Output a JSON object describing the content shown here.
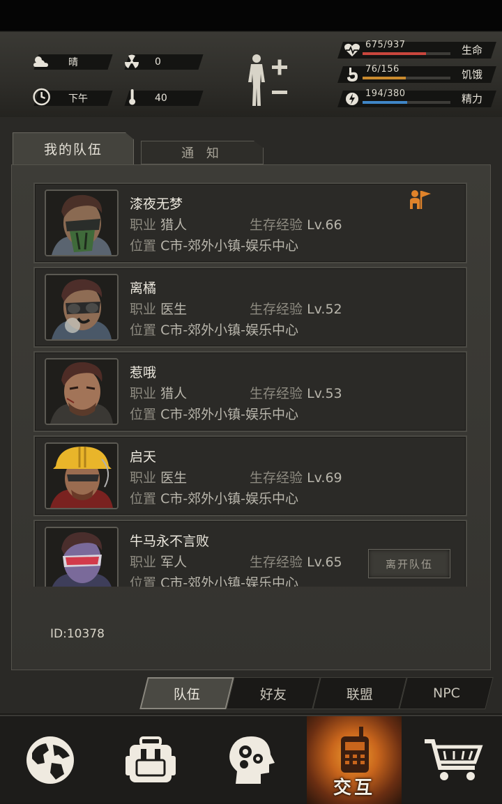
{
  "status": {
    "weather": {
      "icon": "cloud-sun-icon",
      "text": "晴"
    },
    "radiation": {
      "icon": "radiation-icon",
      "text": "0"
    },
    "time": {
      "icon": "clock-icon",
      "text": "下午"
    },
    "temperature": {
      "icon": "thermometer-icon",
      "text": "40"
    },
    "stats": [
      {
        "icon": "heart-pulse-icon",
        "value": "675/937",
        "label": "生命",
        "color": "#c9463d",
        "fraction": 0.72
      },
      {
        "icon": "stomach-icon",
        "value": "76/156",
        "label": "饥饿",
        "color": "#c98a2e",
        "fraction": 0.49
      },
      {
        "icon": "energy-icon",
        "value": "194/380",
        "label": "精力",
        "color": "#3f86c7",
        "fraction": 0.51
      }
    ]
  },
  "tabs": {
    "my_team": "我的队伍",
    "notice": "通 知"
  },
  "member_prefix": {
    "job": "职业",
    "exp": "生存经验",
    "loc": "位置"
  },
  "members": [
    {
      "name": "漆夜无梦",
      "job": "猎人",
      "exp_level": "Lv.66",
      "location": "C市-郊外小镇-娱乐中心",
      "leader": true
    },
    {
      "name": "离橘",
      "job": "医生",
      "exp_level": "Lv.52",
      "location": "C市-郊外小镇-娱乐中心",
      "leader": false
    },
    {
      "name": "惹哦",
      "job": "猎人",
      "exp_level": "Lv.53",
      "location": "C市-郊外小镇-娱乐中心",
      "leader": false
    },
    {
      "name": "启天",
      "job": "医生",
      "exp_level": "Lv.69",
      "location": "C市-郊外小镇-娱乐中心",
      "leader": false
    },
    {
      "name": "牛马永不言败",
      "job": "军人",
      "exp_level": "Lv.65",
      "location": "C市-郊外小镇-娱乐中心",
      "leader": false
    }
  ],
  "leave_button": "离开队伍",
  "user_id": "ID:10378",
  "subtabs": [
    "队伍",
    "好友",
    "联盟",
    "NPC"
  ],
  "nav": {
    "items": [
      {
        "icon": "globe-icon"
      },
      {
        "icon": "backpack-icon"
      },
      {
        "icon": "head-gears-icon"
      },
      {
        "icon": "walkie-talkie-icon",
        "label": "交互"
      },
      {
        "icon": "cart-icon"
      }
    ]
  }
}
